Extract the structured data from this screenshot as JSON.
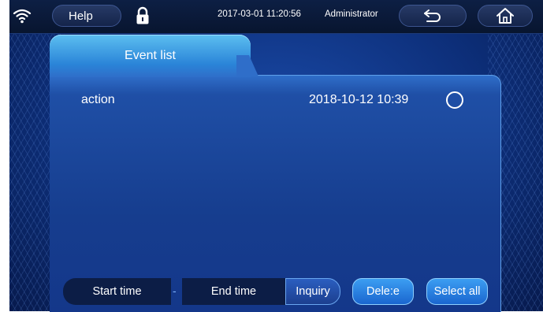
{
  "topbar": {
    "help_label": "Help",
    "date": "2017-03-01",
    "time": "11:20:56",
    "user": "Administrator",
    "icons": {
      "wifi": "wifi-icon",
      "lock": "lock-icon",
      "back": "back-arrow-icon",
      "home": "home-icon"
    }
  },
  "tabs": [
    {
      "label": "Event list",
      "active": true
    }
  ],
  "events": [
    {
      "name": "action",
      "timestamp": "2018-10-12 10:39",
      "selected": false
    }
  ],
  "filter": {
    "start_label": "Start time",
    "separator": "-",
    "end_label": "End time",
    "inquiry_label": "Inquiry"
  },
  "actions": {
    "delete_label": "Dele:e",
    "select_all_label": "Select all"
  },
  "colors": {
    "background": "#0d2f7a",
    "panel": "#163d8e",
    "tab_active": "#2a84d8",
    "button": "#1a66cf",
    "topbar": "#08152f"
  }
}
